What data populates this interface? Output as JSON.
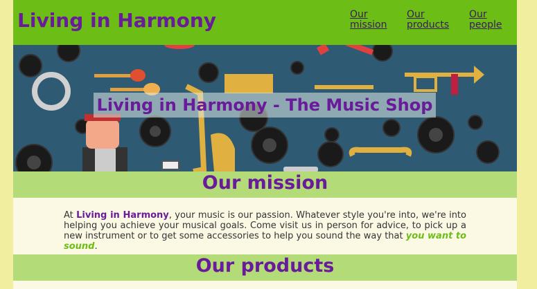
{
  "header": {
    "site_title": "Living in Harmony",
    "nav": [
      {
        "line1": "Our",
        "line2": "mission"
      },
      {
        "line1": "Our",
        "line2": "products"
      },
      {
        "line1": "Our",
        "line2": "people"
      }
    ]
  },
  "hero": {
    "title": "Living in Harmony - The Music Shop"
  },
  "mission": {
    "heading": "Our mission",
    "intro_prefix": "At ",
    "brand": "Living in Harmony",
    "body": ", your music is our passion. Whatever style you're into, we're into helping you achieve your musical goals. Come visit us in person for advice, to pick up a new instrument or to get some accessories to help you sound the way that ",
    "emphasis": "you want to sound",
    "suffix": "."
  },
  "products": {
    "heading": "Our products"
  },
  "colors": {
    "header_bg": "#6cbd16",
    "title_purple": "#6a1b9a",
    "band_bg": "#b3dc79",
    "page_bg": "#f2eea0",
    "hero_bg": "#2f5a73"
  }
}
